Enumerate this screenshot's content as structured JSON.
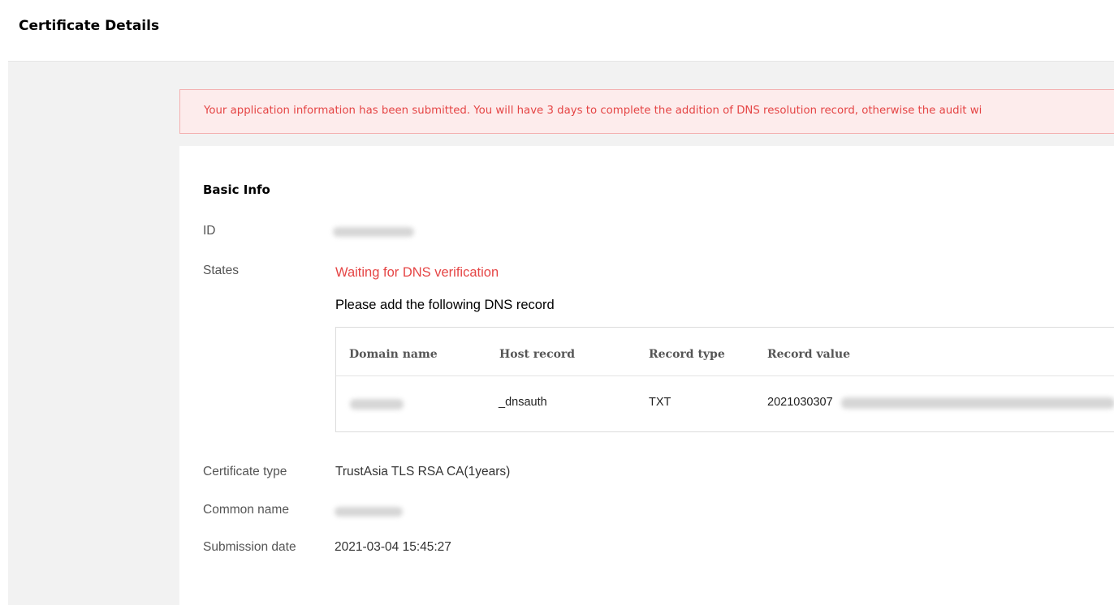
{
  "header": {
    "title": "Certificate Details"
  },
  "alert": {
    "text": "Your application information has been submitted. You will have 3 days to complete the addition of DNS resolution record, otherwise the audit wi"
  },
  "basic_info": {
    "title": "Basic Info",
    "id_label": "ID",
    "states_label": "States",
    "status_text": "Waiting for DNS verification",
    "dns_hint": "Please add the following DNS record",
    "dns_table": {
      "columns": [
        "Domain name",
        "Host record",
        "Record type",
        "Record value"
      ],
      "row": {
        "host_record": "_dnsauth",
        "record_type": "TXT",
        "record_value": "2021030307"
      }
    },
    "certificate_type_label": "Certificate type",
    "certificate_type_value": "TrustAsia TLS RSA CA(1years)",
    "common_name_label": "Common name",
    "submission_date_label": "Submission date",
    "submission_date_value": "2021-03-04 15:45:27"
  }
}
